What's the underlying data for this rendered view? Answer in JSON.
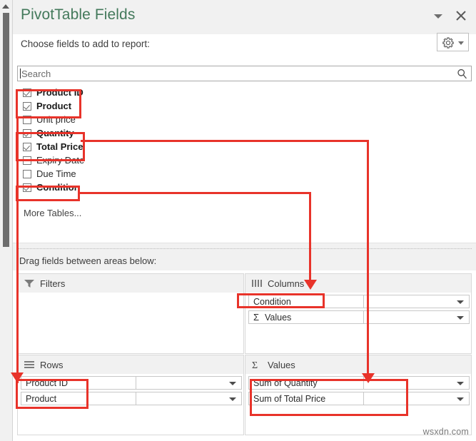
{
  "window": {
    "title": "PivotTable Fields",
    "collapse_icon": "chevron-down-icon",
    "close_icon": "close-icon"
  },
  "header": {
    "choose_label": "Choose fields to add to report:",
    "tools_icon": "gear-icon",
    "tools_caret_icon": "chevron-down-icon"
  },
  "search": {
    "placeholder": "Search",
    "value": "",
    "icon": "search-icon"
  },
  "field_list": {
    "fields": [
      {
        "label": "Product ID",
        "checked": true
      },
      {
        "label": "Product",
        "checked": true
      },
      {
        "label": "Unit price",
        "checked": false
      },
      {
        "label": "Quantity",
        "checked": true
      },
      {
        "label": "Total Price",
        "checked": true
      },
      {
        "label": "Expiry Date",
        "checked": false
      },
      {
        "label": "Due Time",
        "checked": false
      },
      {
        "label": "Condition",
        "checked": true
      }
    ],
    "more_tables_label": "More Tables..."
  },
  "areas": {
    "drag_label": "Drag fields between areas below:",
    "filters": {
      "label": "Filters",
      "icon": "filter-icon",
      "items": []
    },
    "columns": {
      "label": "Columns",
      "icon": "columns-icon",
      "items": [
        {
          "label": "Condition",
          "sigma": false,
          "caret_icon": "chevron-down-icon"
        },
        {
          "label": "Values",
          "sigma": true,
          "caret_icon": "chevron-down-icon"
        }
      ]
    },
    "rows": {
      "label": "Rows",
      "icon": "rows-icon",
      "items": [
        {
          "label": "Product ID",
          "sigma": false,
          "caret_icon": "chevron-down-icon"
        },
        {
          "label": "Product",
          "sigma": false,
          "caret_icon": "chevron-down-icon"
        }
      ]
    },
    "values": {
      "label": "Values",
      "icon": "sigma-icon",
      "items": [
        {
          "label": "Sum of Quantity",
          "sigma": false,
          "caret_icon": "chevron-down-icon"
        },
        {
          "label": "Sum of Total Price",
          "sigma": false,
          "caret_icon": "chevron-down-icon"
        }
      ]
    }
  },
  "annotations": {
    "color": "#e8332a",
    "highlight_boxes": [
      "product-id-and-product-fields",
      "quantity-and-total-price-fields",
      "condition-field",
      "columns-condition-chip",
      "rows-product-chips",
      "values-sum-chips"
    ],
    "arrows": [
      "product-fields-to-rows-area",
      "quantity-total-price-to-values-area",
      "condition-to-columns-area"
    ]
  },
  "watermark": {
    "text": "wsxdn.com"
  },
  "scrollbar": {
    "up_icon": "scroll-up-arrow-icon"
  }
}
